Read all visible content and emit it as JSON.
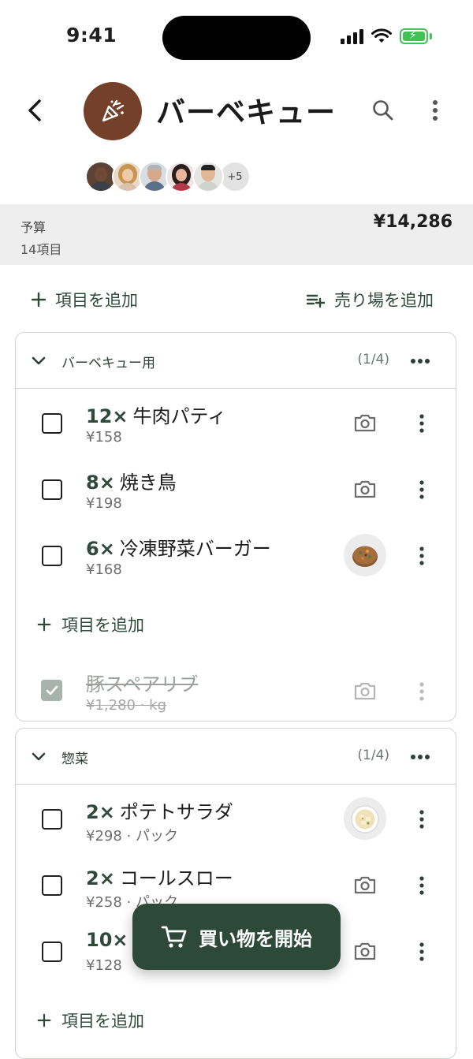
{
  "status": {
    "time": "9:41"
  },
  "header": {
    "title": "バーベキュー",
    "avatars_more": "+5"
  },
  "budget": {
    "label": "予算",
    "count": "14項目",
    "total": "¥14,286"
  },
  "actions": {
    "add_item": "項目を追加",
    "add_section": "売り場を追加"
  },
  "sections": [
    {
      "name": "バーベキュー用",
      "count": "(1/4)",
      "items": [
        {
          "qty": "12×",
          "name": "牛肉パティ",
          "price": "¥158",
          "media": "camera"
        },
        {
          "qty": "8×",
          "name": "焼き鳥",
          "price": "¥198",
          "media": "camera"
        },
        {
          "qty": "6×",
          "name": "冷凍野菜バーガー",
          "price": "¥168",
          "media": "photo"
        }
      ],
      "add_label": "項目を追加",
      "completed": [
        {
          "name": "豚スペアリブ",
          "price": "¥1,280 · kg",
          "checked": true
        }
      ]
    },
    {
      "name": "惣菜",
      "count": "(1/4)",
      "items": [
        {
          "qty": "2×",
          "name": "ポテトサラダ",
          "price": "¥298 · パック",
          "media": "photo"
        },
        {
          "qty": "2×",
          "name": "コールスロー",
          "price": "¥258 · パック",
          "media": "camera"
        },
        {
          "qty": "10×",
          "name": "",
          "price": "¥128",
          "media": "camera"
        }
      ],
      "add_label": "項目を追加"
    }
  ],
  "fab": {
    "label": "買い物を開始"
  },
  "colors": {
    "accent": "#2d4a39",
    "list_icon": "#74402a",
    "battery": "#41c256"
  }
}
